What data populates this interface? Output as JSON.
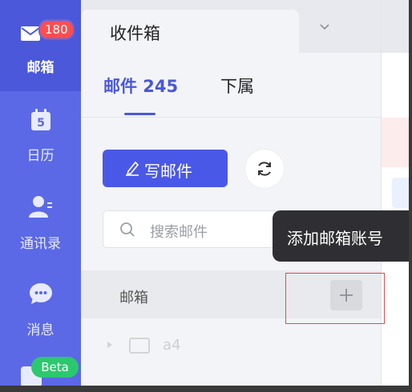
{
  "nav": {
    "mail": {
      "label": "邮箱",
      "badge": "180"
    },
    "calendar": {
      "label": "日历",
      "day": "5"
    },
    "contacts": {
      "label": "通讯录"
    },
    "messages": {
      "label": "消息"
    },
    "beta": {
      "badge": "Beta"
    }
  },
  "panel": {
    "tab_title": "收件箱",
    "subtabs": {
      "mail": "邮件 245",
      "subordinates": "下属"
    },
    "compose_label": "写邮件",
    "search_placeholder": "搜索邮件",
    "section_label": "邮箱",
    "account_row": "a4"
  },
  "tooltip": "添加邮箱账号",
  "colors": {
    "nav_bg": "#5b69e6",
    "accent": "#4a58e8",
    "badge": "#ff4d4f",
    "beta": "#2cc86e",
    "tooltip_bg": "#2f2f33",
    "highlight": "#e04b4b"
  }
}
